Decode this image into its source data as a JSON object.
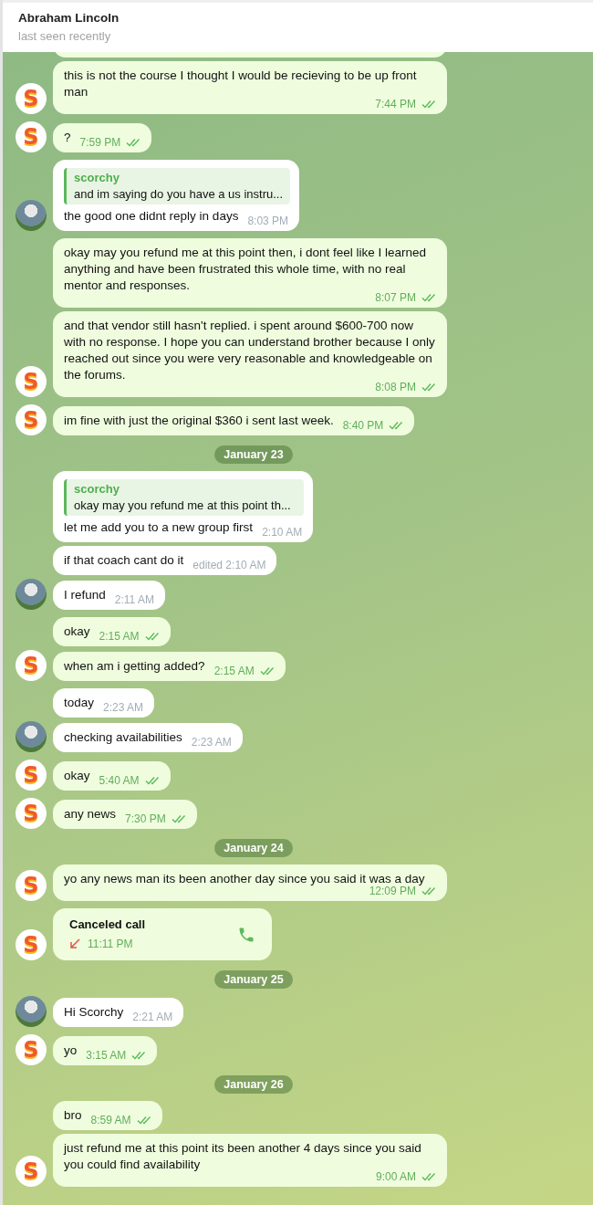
{
  "header": {
    "title": "Abraham Lincoln",
    "status": "last seen recently"
  },
  "messages": [
    {
      "kind": "out",
      "text": "this is not the course I thought I would be recieving to be up front man",
      "time": "7:44 PM",
      "avatar": {
        "kind": "logo",
        "letter": "S"
      }
    },
    {
      "kind": "out",
      "text": "?",
      "time": "7:59 PM",
      "avatar": {
        "kind": "logo",
        "letter": "S"
      }
    },
    {
      "kind": "in",
      "reply": {
        "name": "scorchy",
        "text": "and im saying do you have a us instru..."
      },
      "text": "the good one didnt reply in days",
      "time": "8:03 PM",
      "avatar": {
        "kind": "photo"
      }
    },
    {
      "kind": "out",
      "text": "okay may you refund me at this point then, i dont feel like I learned anything and have been frustrated this whole time, with no real mentor and responses.",
      "time": "8:07 PM"
    },
    {
      "kind": "out",
      "text": "and that vendor still hasn't replied. i spent around $600-700 now with no response. I hope you can understand brother because I only reached out since you were very reasonable and knowledgeable on the forums.",
      "time": "8:08 PM",
      "avatar": {
        "kind": "logo",
        "letter": "S"
      }
    },
    {
      "kind": "out",
      "text": "im fine with just the original $360 i sent last week.",
      "time": "8:40 PM",
      "avatar": {
        "kind": "logo",
        "letter": "S"
      }
    },
    {
      "kind": "date",
      "text": "January 23"
    },
    {
      "kind": "in",
      "reply": {
        "name": "scorchy",
        "text": "okay may you refund me at this point th..."
      },
      "text": "let me add you to a new group first",
      "time": "2:10 AM"
    },
    {
      "kind": "in",
      "text": "if that coach cant do it",
      "time": "edited 2:10 AM"
    },
    {
      "kind": "in",
      "text": "I refund",
      "time": "2:11 AM",
      "avatar": {
        "kind": "photo"
      }
    },
    {
      "kind": "out",
      "text": "okay",
      "time": "2:15 AM"
    },
    {
      "kind": "out",
      "text": "when am i getting added?",
      "time": "2:15 AM",
      "avatar": {
        "kind": "logo",
        "letter": "S"
      }
    },
    {
      "kind": "in",
      "text": "today",
      "time": "2:23 AM"
    },
    {
      "kind": "in",
      "text": "checking availabilities",
      "time": "2:23 AM",
      "avatar": {
        "kind": "photo"
      }
    },
    {
      "kind": "out",
      "text": "okay",
      "time": "5:40 AM",
      "avatar": {
        "kind": "logo",
        "letter": "S"
      }
    },
    {
      "kind": "out",
      "text": "any news",
      "time": "7:30 PM",
      "avatar": {
        "kind": "logo",
        "letter": "S"
      }
    },
    {
      "kind": "date",
      "text": "January 24"
    },
    {
      "kind": "out",
      "text": "yo any news man its been another day since you said it was a day",
      "time": "12:09 PM",
      "avatar": {
        "kind": "logo",
        "letter": "S"
      }
    },
    {
      "kind": "call",
      "text": "Canceled call",
      "time": "11:11 PM",
      "avatar": {
        "kind": "logo",
        "letter": "S"
      }
    },
    {
      "kind": "date",
      "text": "January 25"
    },
    {
      "kind": "in",
      "text": "Hi Scorchy",
      "time": "2:21 AM",
      "avatar": {
        "kind": "photo"
      }
    },
    {
      "kind": "out",
      "text": "yo",
      "time": "3:15 AM",
      "avatar": {
        "kind": "logo",
        "letter": "S"
      }
    },
    {
      "kind": "date",
      "text": "January 26"
    },
    {
      "kind": "out",
      "text": "bro",
      "time": "8:59 AM"
    },
    {
      "kind": "out",
      "text": "just refund me at this point its been another 4 days since you said you could find availability",
      "time": "9:00 AM",
      "avatar": {
        "kind": "logo",
        "letter": "S"
      }
    }
  ]
}
